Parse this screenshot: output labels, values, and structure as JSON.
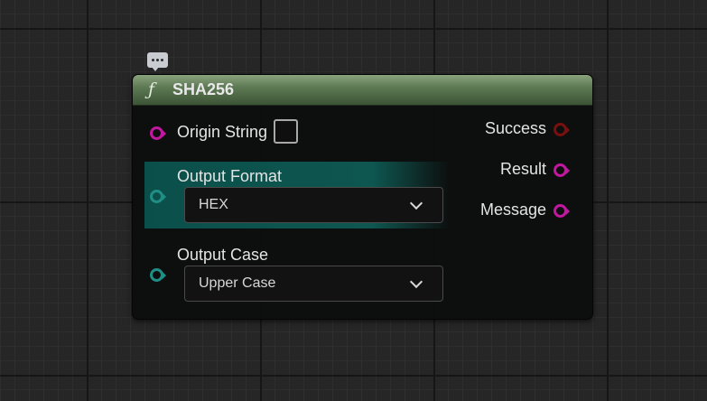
{
  "node": {
    "title": "SHA256",
    "icon": "function-icon"
  },
  "inputs": {
    "origin_string": {
      "label": "Origin String",
      "checked": false
    },
    "output_format": {
      "label": "Output Format",
      "value": "HEX"
    },
    "output_case": {
      "label": "Output Case",
      "value": "Upper Case"
    }
  },
  "outputs": {
    "success": {
      "label": "Success"
    },
    "result": {
      "label": "Result"
    },
    "message": {
      "label": "Message"
    }
  },
  "colors": {
    "string_pin": "#c2189f",
    "enum_pin": "#1f8f86",
    "bool_pin": "#7a0f0f",
    "header": "#5e7a54"
  }
}
